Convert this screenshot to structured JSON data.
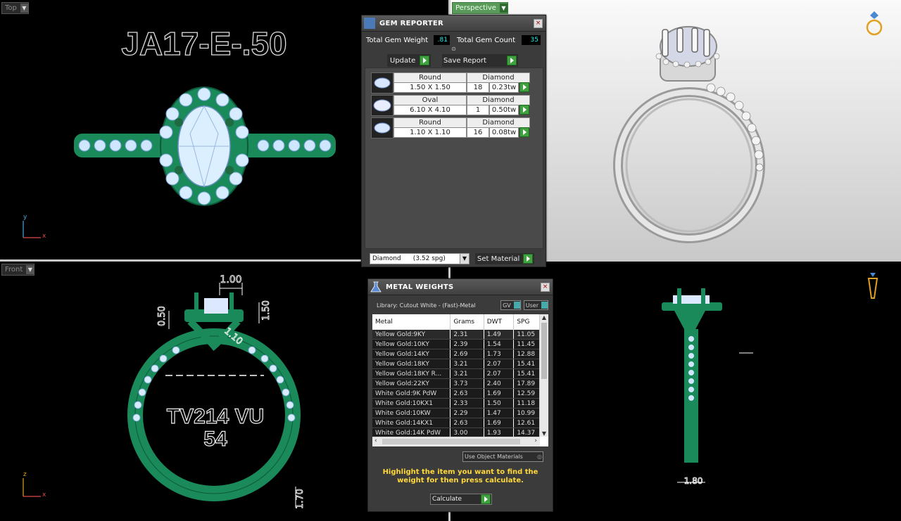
{
  "viewports": {
    "top": {
      "label": "Top",
      "title_text": "JA17-E-.50",
      "axis_y": "y",
      "axis_x": "x"
    },
    "perspective": {
      "label": "Perspective"
    },
    "front": {
      "label": "Front",
      "text_line1": "TV214 VU",
      "text_line2": "54",
      "axis_y": "z",
      "axis_x": "x",
      "dims": {
        "top_width": "1.00",
        "left_height": "0.50",
        "right_height": "1.50",
        "diag": "1.10",
        "bottom": "1.70"
      }
    },
    "side": {
      "dim_bottom": "1.80"
    }
  },
  "gem_reporter": {
    "title": "GEM REPORTER",
    "total_weight_label": "Total Gem Weight",
    "total_weight_value": ".81",
    "total_count_label": "Total Gem Count",
    "total_count_value": "35",
    "update_label": "Update",
    "save_label": "Save Report",
    "gems": [
      {
        "shape": "Round",
        "type": "Diamond",
        "size": "1.50 X 1.50",
        "count": "18",
        "weight": "0.23tw"
      },
      {
        "shape": "Oval",
        "type": "Diamond",
        "size": "6.10 X 4.10",
        "count": "1",
        "weight": "0.50tw"
      },
      {
        "shape": "Round",
        "type": "Diamond",
        "size": "1.10 X 1.10",
        "count": "16",
        "weight": "0.08tw"
      }
    ],
    "material_select": "Diamond      (3.52 spg)",
    "set_material_label": "Set Material"
  },
  "metal_weights": {
    "title": "METAL WEIGHTS",
    "library": "Library: Cutout White - (Fast)-Metal",
    "gv_label": "GV",
    "user_label": "User",
    "columns": [
      "Metal",
      "Grams",
      "DWT",
      "SPG"
    ],
    "rows": [
      [
        "Yellow Gold:9KY",
        "2.31",
        "1.49",
        "11.05"
      ],
      [
        "Yellow Gold:10KY",
        "2.39",
        "1.54",
        "11.45"
      ],
      [
        "Yellow Gold:14KY",
        "2.69",
        "1.73",
        "12.88"
      ],
      [
        "Yellow Gold:18KY",
        "3.21",
        "2.07",
        "15.41"
      ],
      [
        "Yellow Gold:18KY R...",
        "3.21",
        "2.07",
        "15.41"
      ],
      [
        "Yellow Gold:22KY",
        "3.73",
        "2.40",
        "17.89"
      ],
      [
        "White Gold:9K PdW",
        "2.63",
        "1.69",
        "12.59"
      ],
      [
        "White Gold:10KX1",
        "2.33",
        "1.50",
        "11.18"
      ],
      [
        "White Gold:10KW",
        "2.29",
        "1.47",
        "10.99"
      ],
      [
        "White Gold:14KX1",
        "2.63",
        "1.69",
        "12.61"
      ],
      [
        "White Gold:14K PdW",
        "3.00",
        "1.93",
        "14.37"
      ]
    ],
    "use_object_materials": "Use Object Materials",
    "hint": "Highlight the item you want to find the weight for then press calculate.",
    "calculate_label": "Calculate"
  }
}
